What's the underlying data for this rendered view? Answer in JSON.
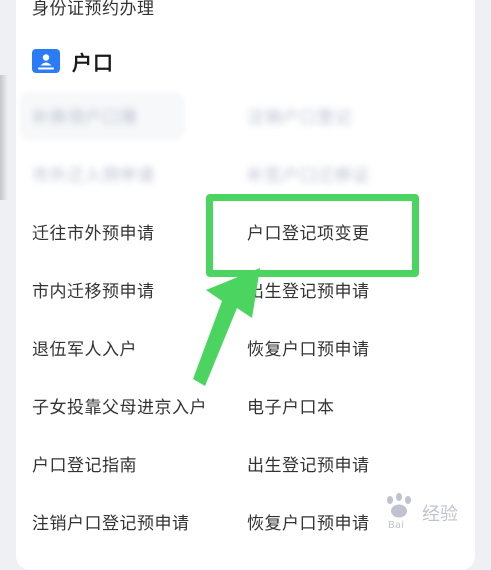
{
  "top_partial_text": "身份证预约办理",
  "section": {
    "title": "户口",
    "icon": "id-card-icon",
    "accent_color": "#2a7cf6"
  },
  "services": {
    "rows": [
      {
        "left": "补换领户口簿",
        "right": "注销户口登记",
        "blurred": true
      },
      {
        "left": "市外迁入预申请",
        "right": "补签户口迁移证",
        "blurred": true
      },
      {
        "left": "迁往市外预申请",
        "right": "户口登记项变更",
        "blurred": false
      },
      {
        "left": "市内迁移预申请",
        "right": "出生登记预申请",
        "blurred": false
      },
      {
        "left": "退伍军人入户",
        "right": "恢复户口预申请",
        "blurred": false
      },
      {
        "left": "子女投靠父母进京入户",
        "right": "电子户口本",
        "blurred": false
      },
      {
        "left": "户口登记指南",
        "right": "出生登记预申请",
        "blurred": false
      },
      {
        "left": "注销户口登记预申请",
        "right": "恢复户口预申请",
        "blurred": false
      }
    ]
  },
  "annotation": {
    "highlight_color": "#4bd560",
    "highlighted_item": "户口登记项变更"
  },
  "watermark": {
    "icon": "paw-logo-icon",
    "text": "经验"
  }
}
